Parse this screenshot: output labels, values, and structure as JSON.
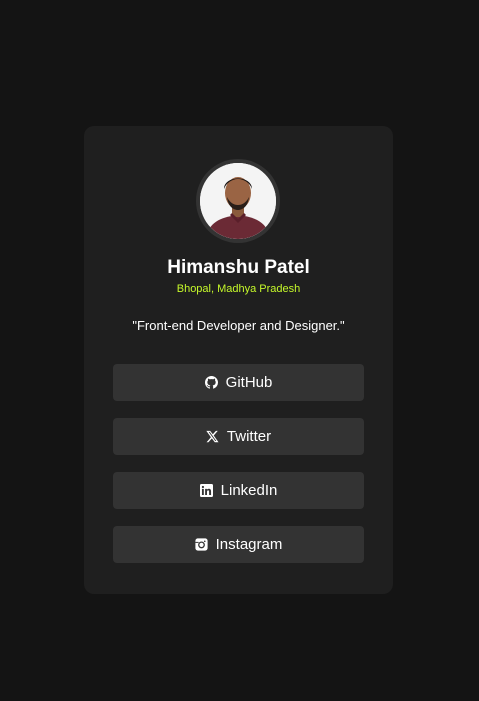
{
  "profile": {
    "name": "Himanshu Patel",
    "location": "Bhopal, Madhya Pradesh",
    "bio": "\"Front-end Developer and Designer.\""
  },
  "links": [
    {
      "label": "GitHub",
      "icon": "github-icon"
    },
    {
      "label": "Twitter",
      "icon": "x-twitter-icon"
    },
    {
      "label": "LinkedIn",
      "icon": "linkedin-icon"
    },
    {
      "label": "Instagram",
      "icon": "instagram-icon"
    }
  ],
  "colors": {
    "page_background": "#141414",
    "card_background": "#1f1f1f",
    "button_background": "#333333",
    "accent": "#c5f82a",
    "text": "#ffffff"
  }
}
